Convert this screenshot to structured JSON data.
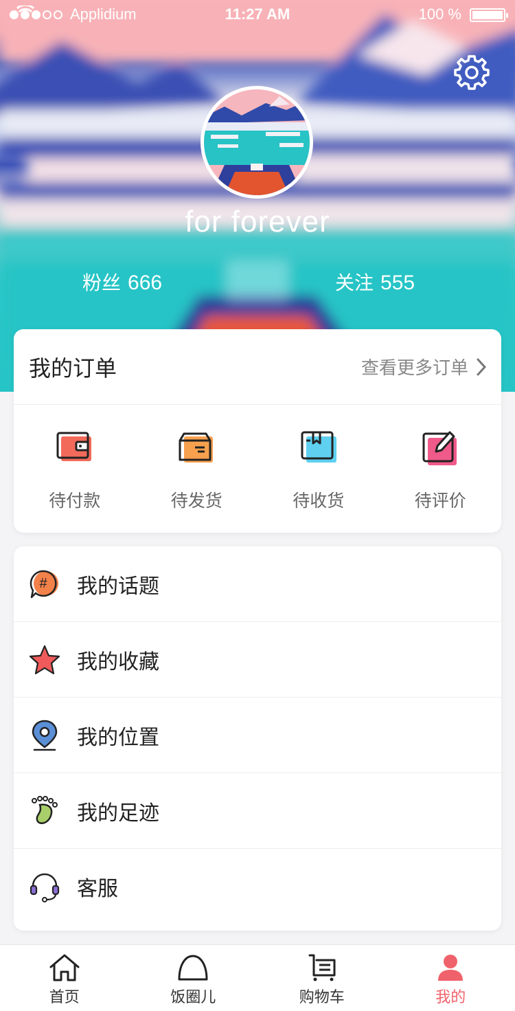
{
  "status_bar": {
    "carrier": "Applidium",
    "time": "11:27 AM",
    "battery": "100 %"
  },
  "profile": {
    "username": "for forever",
    "fans_label": "粉丝",
    "fans_count": "666",
    "follow_label": "关注",
    "follow_count": "555"
  },
  "orders": {
    "title": "我的订单",
    "more": "查看更多订单",
    "items": [
      {
        "label": "待付款",
        "icon": "wallet-icon",
        "color": "#f26a5a"
      },
      {
        "label": "待发货",
        "icon": "box-icon",
        "color": "#f7a04e"
      },
      {
        "label": "待收货",
        "icon": "package-icon",
        "color": "#5fd0f0"
      },
      {
        "label": "待评价",
        "icon": "edit-icon",
        "color": "#f05a8a"
      }
    ]
  },
  "menu": [
    {
      "label": "我的话题",
      "icon": "topic-icon"
    },
    {
      "label": "我的收藏",
      "icon": "star-icon"
    },
    {
      "label": "我的位置",
      "icon": "location-icon"
    },
    {
      "label": "我的足迹",
      "icon": "footprint-icon"
    },
    {
      "label": "客服",
      "icon": "headset-icon"
    }
  ],
  "tabbar": [
    {
      "label": "首页",
      "icon": "home-icon"
    },
    {
      "label": "饭圈儿",
      "icon": "circle-icon"
    },
    {
      "label": "购物车",
      "icon": "cart-icon"
    },
    {
      "label": "我的",
      "icon": "user-icon",
      "active": true
    }
  ],
  "colors": {
    "accent": "#f0626b",
    "teal": "#26c4c6"
  }
}
